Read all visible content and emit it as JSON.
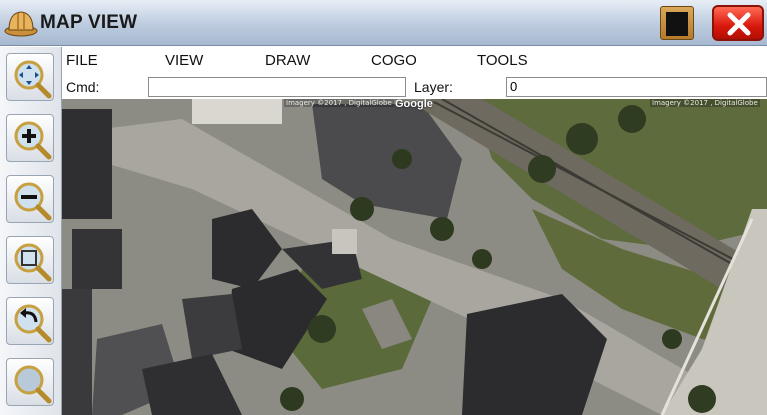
{
  "window": {
    "title": "MAP VIEW",
    "close_symbol": "X"
  },
  "menu": {
    "items": [
      "FILE",
      "VIEW",
      "DRAW",
      "COGO",
      "TOOLS"
    ]
  },
  "command_bar": {
    "cmd_label": "Cmd:",
    "cmd_value": "",
    "layer_label": "Layer:",
    "layer_value": "0"
  },
  "toolbar": {
    "tools": [
      "pan-icon",
      "zoom-in-icon",
      "zoom-out-icon",
      "zoom-window-icon",
      "zoom-previous-icon",
      "zoom-extents-icon"
    ]
  },
  "map": {
    "credit_left": "Imagery ©2017 , DigitalGlobe",
    "google_logo": "Google",
    "credit_right": "Imagery ©2017 , DigitalGlobe"
  },
  "colors": {
    "close_button": "#d8180c",
    "titlebar": "#bccbde"
  }
}
